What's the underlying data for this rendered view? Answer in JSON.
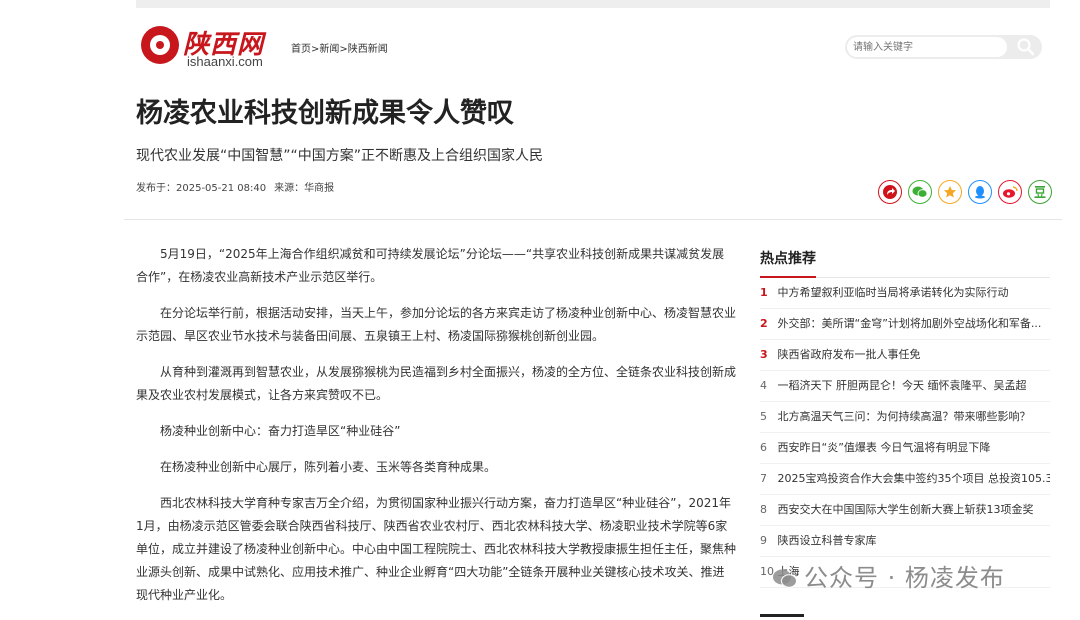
{
  "header": {
    "logo_cn": "陕西网",
    "logo_en": "ishaanxi.com",
    "breadcrumb": [
      "首页",
      "新闻",
      "陕西新闻"
    ],
    "breadcrumb_sep": ">",
    "search_placeholder": "请输入关键字"
  },
  "article": {
    "title": "杨凌农业科技创新成果令人赞叹",
    "subtitle": "现代农业发展“中国智慧”“中国方案”正不断惠及上合组织国家人民",
    "published": "发布于：2025-05-21 08:40",
    "source": "来源：华商报",
    "paragraphs": [
      "5月19日，“2025年上海合作组织减贫和可持续发展论坛”分论坛——“共享农业科技创新成果共谋减贫发展合作”，在杨凌农业高新技术产业示范区举行。",
      "在分论坛举行前，根据活动安排，当天上午，参加分论坛的各方来宾走访了杨凌种业创新中心、杨凌智慧农业示范园、旱区农业节水技术与装备田间展、五泉镇王上村、杨凌国际猕猴桃创新创业园。",
      "从育种到灌溉再到智慧农业，从发展猕猴桃为民造福到乡村全面振兴，杨凌的全方位、全链条农业科技创新成果及农业农村发展模式，让各方来宾赞叹不已。",
      "杨凌种业创新中心：奋力打造旱区“种业硅谷”",
      "在杨凌种业创新中心展厅，陈列着小麦、玉米等各类育种成果。",
      "西北农林科技大学育种专家吉万全介绍，为贯彻国家种业振兴行动方案，奋力打造旱区“种业硅谷”，2021年1月，由杨凌示范区管委会联合陕西省科技厅、陕西省农业农村厅、西北农林科技大学、杨凌职业技术学院等6家单位，成立并建设了杨凌种业创新中心。中心由中国工程院院士、西北农林科技大学教授康振生担任主任，聚焦种业源头创新、成果中试熟化、应用技术推广、种业企业孵育“四大功能”全链条开展种业关键核心技术攻关、推进现代种业产业化。"
    ]
  },
  "share": {
    "icons": [
      "share-icon",
      "wechat-icon",
      "qzone-icon",
      "qq-icon",
      "weibo-icon",
      "douban-icon"
    ],
    "colors": [
      "#d0121b",
      "#3cb034",
      "#f5a623",
      "#1e90ff",
      "#e6162d",
      "#3aa335"
    ]
  },
  "hot": {
    "title": "热点推荐",
    "items": [
      {
        "num": "1",
        "text": "中方希望叙利亚临时当局将承诺转化为实际行动"
      },
      {
        "num": "2",
        "text": "外交部：美所谓“金穹”计划将加剧外空战场化和军备..."
      },
      {
        "num": "3",
        "text": "陕西省政府发布一批人事任免"
      },
      {
        "num": "4",
        "text": "一稻济天下 肝胆两昆仑！今天 缅怀袁隆平、吴孟超"
      },
      {
        "num": "5",
        "text": "北方高温天气三问：为何持续高温？带来哪些影响？"
      },
      {
        "num": "6",
        "text": "西安昨日“炎”值爆表 今日气温将有明显下降"
      },
      {
        "num": "7",
        "text": "2025宝鸡投资合作大会集中签约35个项目 总投资105.3..."
      },
      {
        "num": "8",
        "text": "西安交大在中国国际大学生创新大赛上斩获13项金奖"
      },
      {
        "num": "9",
        "text": "陕西设立科普专家库"
      },
      {
        "num": "10",
        "text": "上海 "
      }
    ]
  },
  "watermark": "公众号 · 杨凌发布",
  "accent_color": "#c8161d"
}
